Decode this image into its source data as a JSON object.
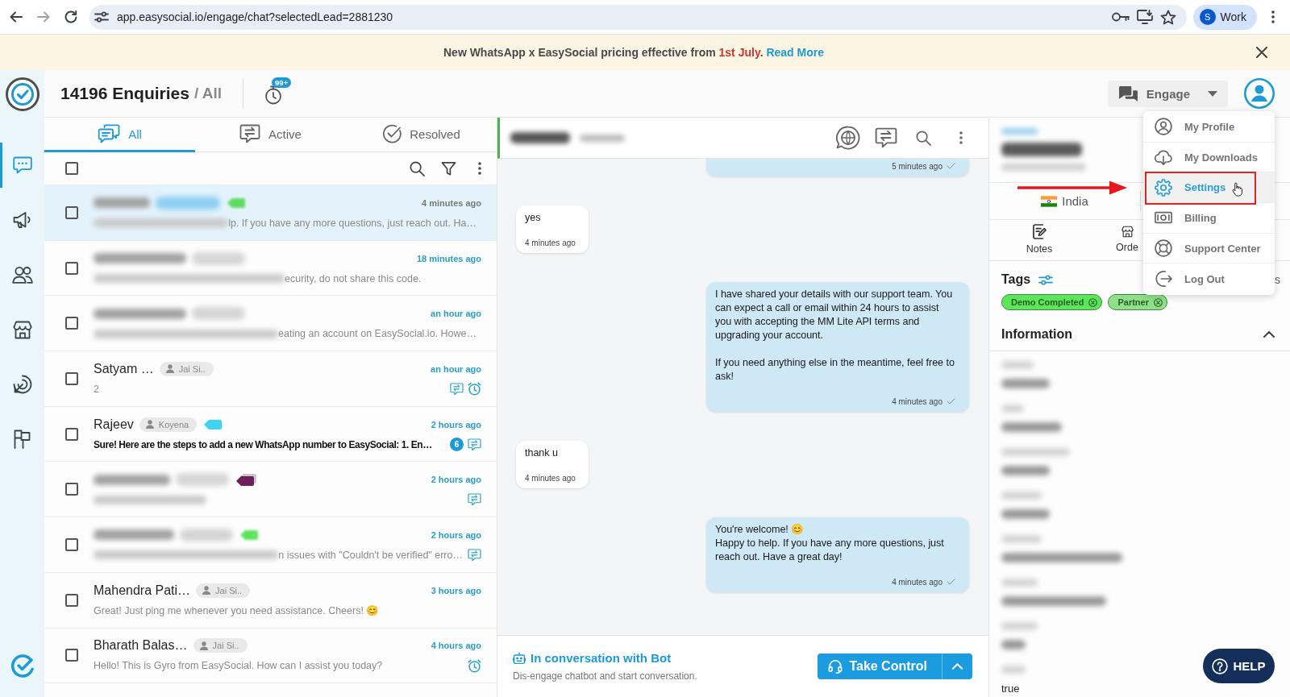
{
  "browser": {
    "url": "app.easysocial.io/engage/chat?selectedLead=2881230",
    "profile_initial": "S",
    "profile_name": "Work"
  },
  "banner": {
    "text": "New WhatsApp x EasySocial pricing effective from",
    "date": "1st July",
    "after_date": ".",
    "link": "Read More"
  },
  "sidebar": {
    "items": [
      {
        "selected": true
      },
      {
        "selected": false
      },
      {
        "selected": false
      },
      {
        "selected": false
      },
      {
        "selected": false
      },
      {
        "selected": false
      }
    ]
  },
  "header": {
    "title": "14196 Enquiries",
    "scope": "/ All",
    "badge": "99+",
    "engage": "Engage"
  },
  "tabs": [
    {
      "label": "All",
      "selected": true
    },
    {
      "label": "Active",
      "selected": false
    },
    {
      "label": "Resolved",
      "selected": false
    }
  ],
  "list": {
    "select_all_checked": false,
    "rows": [
      {
        "selected": true,
        "checked": false,
        "redacted": true,
        "tag": {
          "color": "#5fdc5f",
          "redacted": true,
          "stacked": false
        },
        "time": "4 minutes ago",
        "preview_redacted": true,
        "preview": "lp. If you have any more questions, just reach out. Ha…",
        "conversation": false,
        "reminder": false
      },
      {
        "selected": false,
        "checked": false,
        "redacted": true,
        "time": "18 minutes ago",
        "preview_redacted": true,
        "preview": "ecurity, do not share this code.",
        "conversation": false,
        "reminder": false
      },
      {
        "selected": false,
        "checked": false,
        "redacted": true,
        "time": "an hour ago",
        "preview_redacted": true,
        "preview": "eating an account on EasySocial.io. Howe…",
        "conversation": false,
        "reminder": false
      },
      {
        "selected": false,
        "checked": false,
        "redacted": false,
        "name": "Satyam …",
        "agent": "Jai Si..",
        "time": "an hour ago",
        "preview_redacted": false,
        "preview": "2",
        "conversation": true,
        "reminder": true
      },
      {
        "selected": false,
        "checked": false,
        "redacted": false,
        "name": "Rajeev",
        "agent": "Koyena",
        "tag": {
          "color": "#3dd5f3",
          "redacted": false,
          "stacked": false
        },
        "time": "2 hours ago",
        "preview_redacted": false,
        "preview": "Sure! Here are the steps to add a new WhatsApp number to EasySocial: 1. En…",
        "unread": "6",
        "conversation": true,
        "reminder": false
      },
      {
        "selected": false,
        "checked": false,
        "redacted": true,
        "tag": {
          "color": "#6b1d5c",
          "redacted": false,
          "stacked": true
        },
        "time": "2 hours ago",
        "preview_redacted": true,
        "conversation": true,
        "reminder": false
      },
      {
        "selected": false,
        "checked": false,
        "redacted": true,
        "tag": {
          "color": "#5ee35e",
          "redacted": true,
          "stacked": false
        },
        "time": "2 hours ago",
        "preview_redacted": true,
        "preview": "n issues with \"Couldn't be verified\" erro…",
        "conversation": true,
        "reminder": false
      },
      {
        "selected": false,
        "checked": false,
        "redacted": false,
        "name": "Mahendra Pati…",
        "agent": "Jai Si..",
        "time": "3 hours ago",
        "preview_redacted": false,
        "preview": "Great! Just ping me whenever you need assistance. Cheers! 😊",
        "conversation": false,
        "reminder": false
      },
      {
        "selected": false,
        "checked": false,
        "redacted": false,
        "name": "Bharath Balas…",
        "agent": "Jai Si..",
        "time": "4 hours ago",
        "preview_redacted": false,
        "preview": "Hello! This is Gyro from EasySocial. How can I assist you today?",
        "conversation": false,
        "reminder": true
      }
    ]
  },
  "chat": {
    "contact_redacted": true,
    "messages": [
      {
        "kind": "outgoing",
        "time": "5 minutes ago",
        "ticked": true
      },
      {
        "kind": "incoming",
        "text": "yes",
        "time": "4 minutes ago",
        "ticked": false
      },
      {
        "kind": "outgoing",
        "text": "I have shared your details with our support team. You can expect a call or email within 24 hours to assist you with accepting the MM Lite API terms and upgrading your account.\n\nIf you need anything else in the meantime, feel free to ask!",
        "time": "4 minutes ago",
        "ticked": true
      },
      {
        "kind": "incoming",
        "text": "thank u",
        "time": "4 minutes ago",
        "ticked": false
      },
      {
        "kind": "outgoing",
        "text": "You're welcome! 😊\nHappy to help. If you have any more questions, just reach out. Have a great day!",
        "time": "4 minutes ago",
        "ticked": true
      }
    ],
    "bot": {
      "title": "In conversation with Bot",
      "subtitle": "Dis-engage chatbot and start conversation.",
      "button": "Take Control"
    }
  },
  "contact": {
    "name_redacted": true,
    "country": "India",
    "tabs": [
      {
        "label": "Notes",
        "selected": false
      },
      {
        "label": "Orde",
        "selected": false
      }
    ],
    "tags_title": "Tags",
    "tags_action": "s",
    "tags": [
      {
        "label": "Demo Completed",
        "color": "#5ee65a"
      },
      {
        "label": "Partner",
        "color": "#8fe08a"
      }
    ],
    "information_title": "Information",
    "information_expanded": true,
    "fields": [
      {
        "value_redacted": true
      },
      {
        "value_redacted": true
      },
      {
        "value_redacted": true
      },
      {
        "value_redacted": true
      },
      {
        "value_redacted": true
      },
      {
        "value_redacted": true
      },
      {
        "value_redacted": true
      },
      {
        "value_redacted": false,
        "value": "true"
      }
    ]
  },
  "menu": {
    "items": [
      {
        "label": "My Profile",
        "selected": false,
        "highlighted": false
      },
      {
        "label": "My Downloads",
        "selected": false,
        "highlighted": false
      },
      {
        "label": "Settings",
        "selected": true,
        "highlighted": true
      },
      {
        "label": "Billing",
        "selected": false,
        "highlighted": false
      },
      {
        "label": "Support Center",
        "selected": false,
        "highlighted": false
      },
      {
        "label": "Log Out",
        "selected": false,
        "highlighted": false
      }
    ]
  },
  "help": {
    "label": "HELP"
  }
}
